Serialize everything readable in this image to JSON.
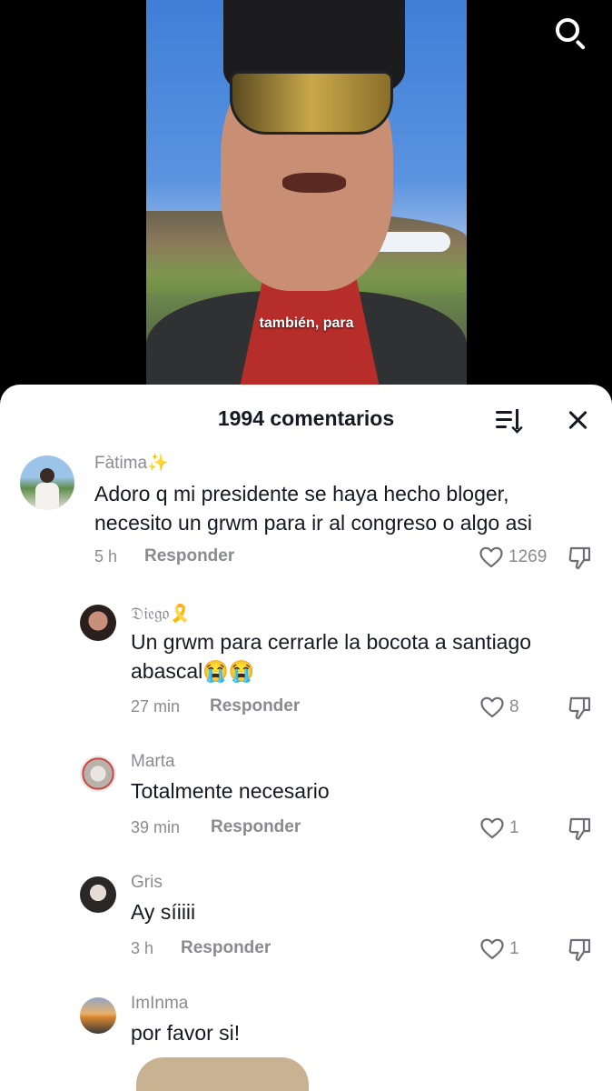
{
  "video": {
    "caption": "también, para"
  },
  "header": {
    "comment_count_title": "1994 comentarios"
  },
  "icons": {
    "search": "search-icon",
    "sort": "sort-icon",
    "close": "close-icon",
    "like": "heart-icon",
    "dislike": "thumbs-down-icon"
  },
  "comments": [
    {
      "username": "Fàtima✨",
      "text_line1": "Adoro q mi presidente se haya hecho bloger,",
      "text_line2": "necesito un grwm para ir al congreso o algo asi",
      "time": "5 h",
      "reply_label": "Responder",
      "likes": "1269"
    },
    {
      "username": "𝔇𝔦𝔢𝔤𝔬🎗️",
      "text_line1": "Un grwm para cerrarle la bocota a santiago",
      "text_line2": "abascal😭😭",
      "time": "27 min",
      "reply_label": "Responder",
      "likes": "8"
    },
    {
      "username": "Marta",
      "text_line1": "Totalmente necesario",
      "time": "39 min",
      "reply_label": "Responder",
      "likes": "1"
    },
    {
      "username": "Gris",
      "text_line1": "Ay síiiii",
      "time": "3 h",
      "reply_label": "Responder",
      "likes": "1"
    },
    {
      "username": "ImInma",
      "text_line1": "por favor si!"
    }
  ]
}
